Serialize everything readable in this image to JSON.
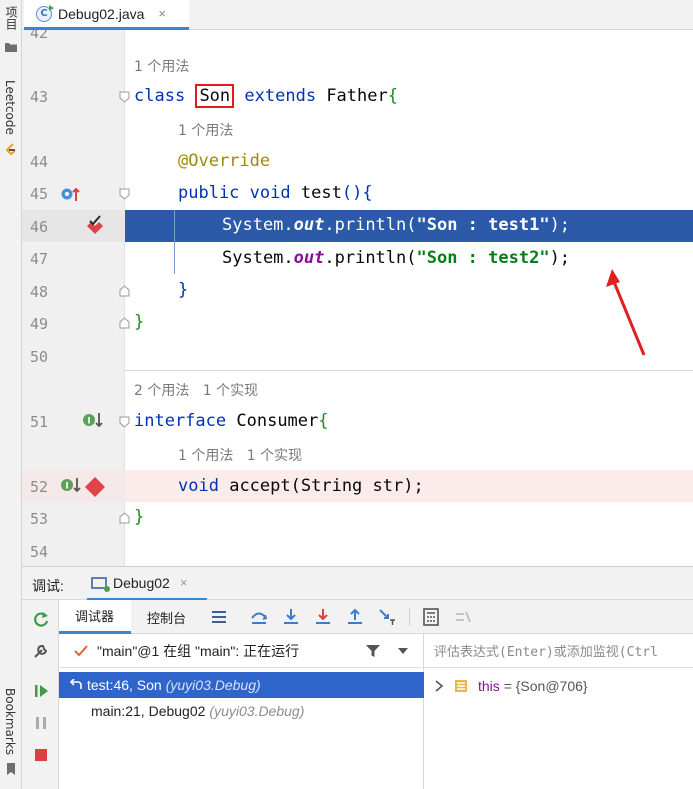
{
  "left_strip": {
    "project_label": "项目",
    "leetcode_label": "Leetcode",
    "bookmarks_label": "Bookmarks"
  },
  "editor_tab": {
    "file_name": "Debug02.java",
    "close_glyph": "×"
  },
  "code_lines": {
    "l42": "42",
    "l43": "43",
    "l44": "44",
    "l45": "45",
    "l46": "46",
    "l47": "47",
    "l48": "48",
    "l49": "49",
    "l50": "50",
    "l51": "51",
    "l52": "52",
    "l53": "53",
    "l54": "54"
  },
  "code": {
    "hint_son_class": "1 个用法",
    "class_kw": "class",
    "class_name": "Son",
    "extends_kw": "extends",
    "parent_name": "Father",
    "hint_test": "1 个用法",
    "override": "@Override",
    "public_kw": "public",
    "void_kw": "void",
    "method_test": "test",
    "system": "System.",
    "out": "out",
    "println": ".println(",
    "str_test1": "\"Son : test1\"",
    "str_test2": "\"Son : test2\"",
    "call_end": ");",
    "hint_consumer": "2 个用法   1 个实现",
    "interface_kw": "interface",
    "consumer_name": "Consumer",
    "hint_accept": "1 个用法   1 个实现",
    "accept_rest": "accept",
    "accept_param": "String str"
  },
  "debug": {
    "header_label": "调试:",
    "session_tab": "Debug02",
    "close_glyph": "×",
    "subtab_debugger": "调试器",
    "subtab_console": "控制台",
    "thread_text": "\"main\"@1 在组 \"main\": 正在运行",
    "frames": [
      {
        "method": "test:46, Son",
        "location": "(yuyi03.Debug)"
      },
      {
        "method": "main:21, Debug02",
        "location": "(yuyi03.Debug)"
      }
    ],
    "eval_placeholder": "评估表达式(Enter)或添加监视(Ctrl",
    "var_name": "this",
    "var_value": "= {Son@706}"
  },
  "colors": {
    "exec_line": "#2a5aa8",
    "breakpoint": "#e0424a",
    "selected_frame": "#2f65ca",
    "accent": "#4083c9"
  }
}
